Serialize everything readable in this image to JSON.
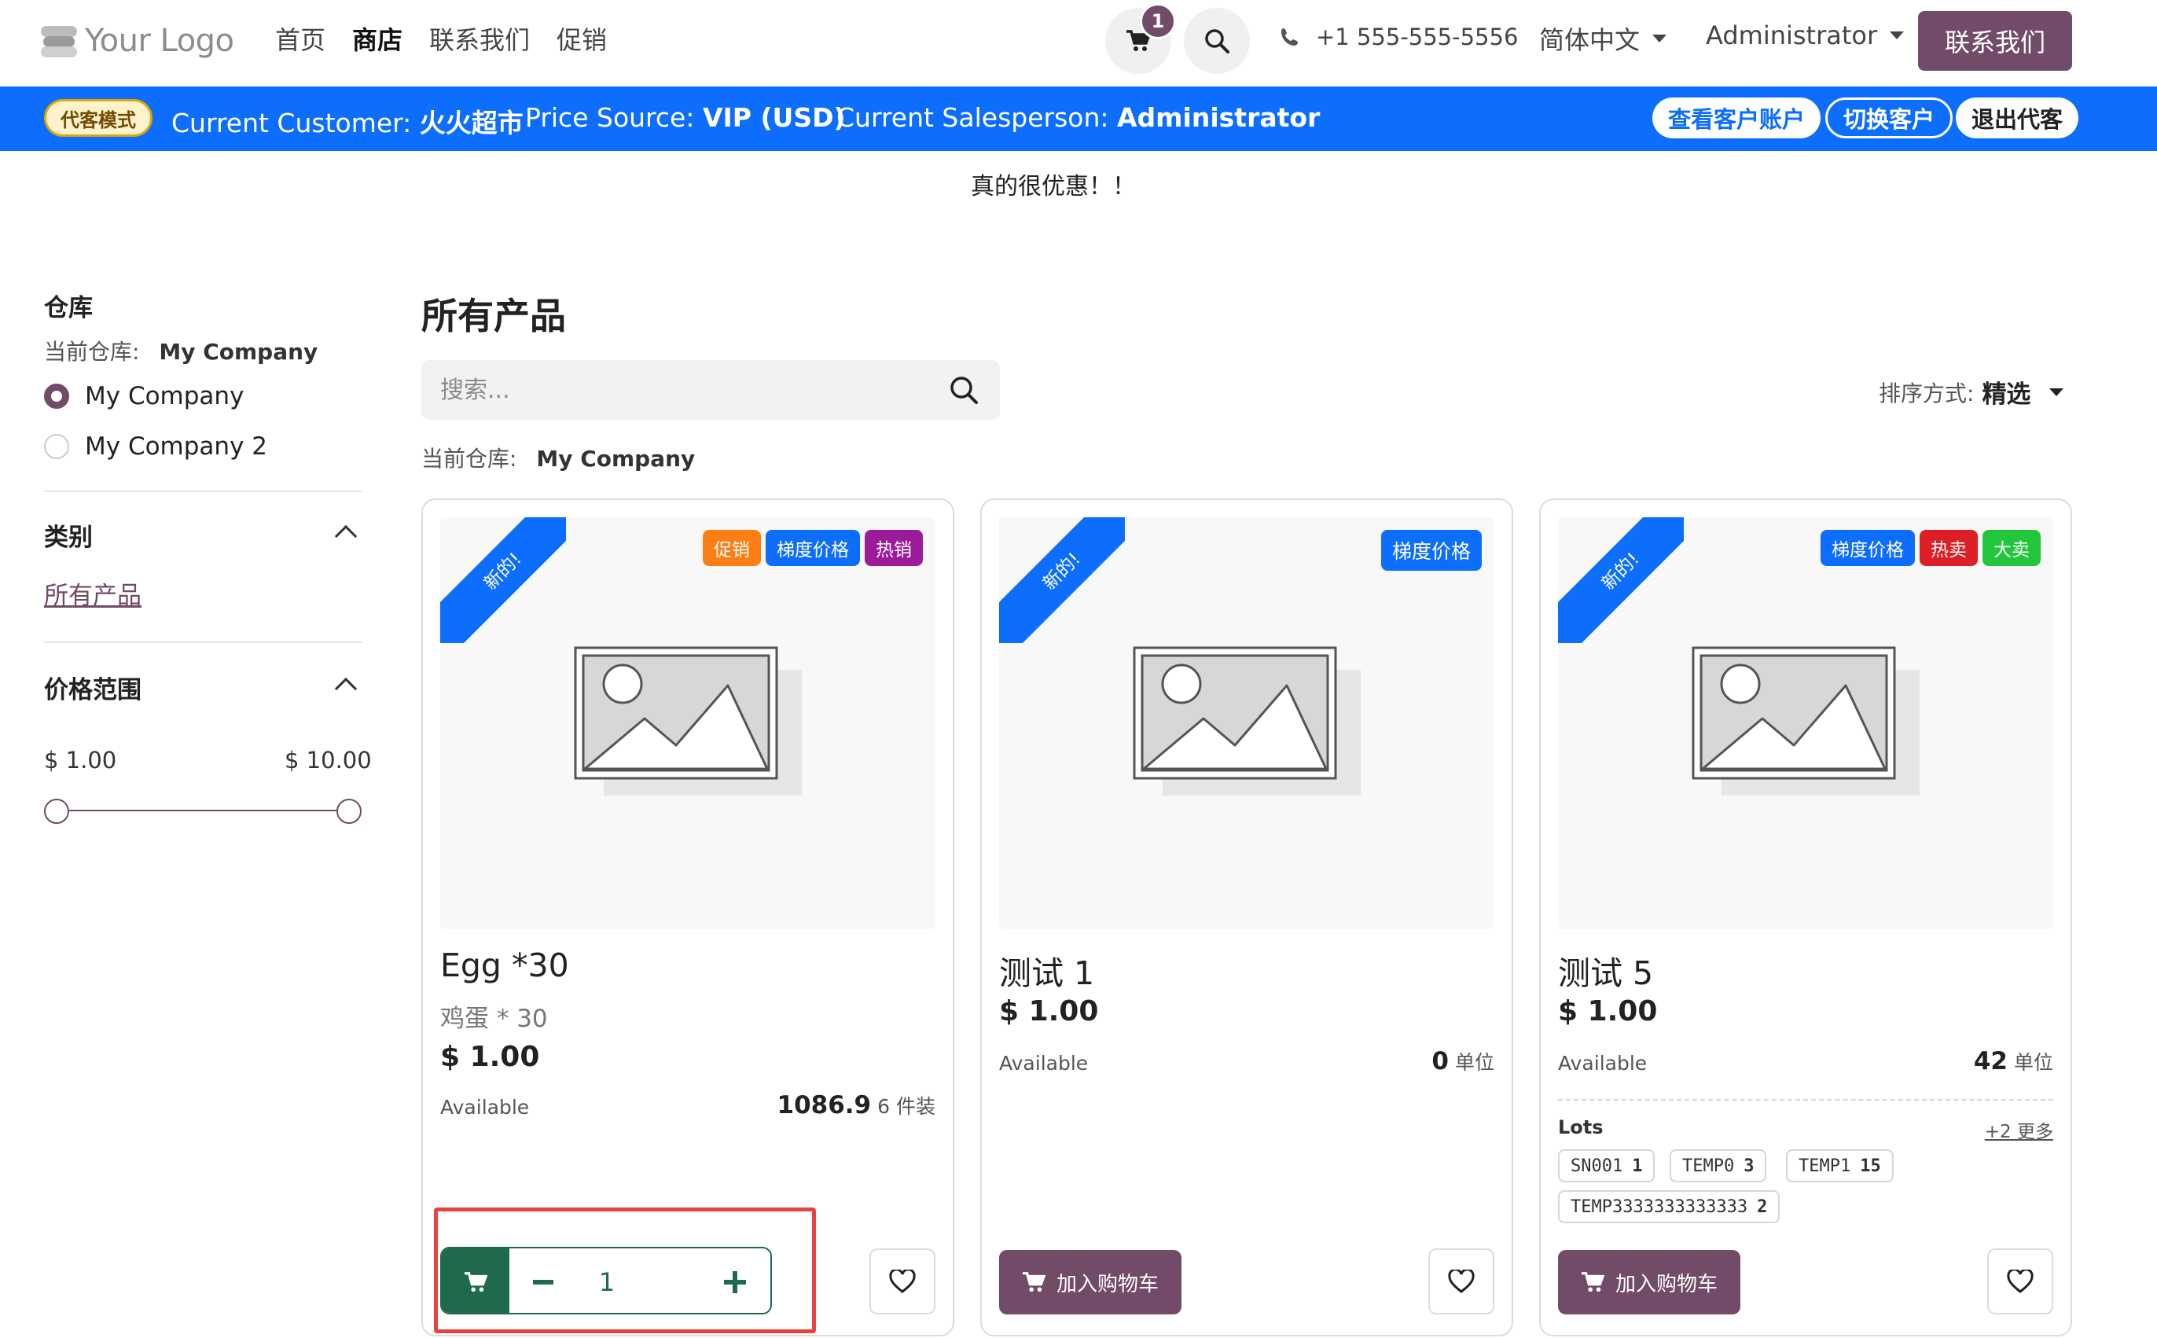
{
  "header": {
    "logo_text": "Your Logo",
    "nav": [
      "首页",
      "商店",
      "联系我们",
      "促销"
    ],
    "active_nav_index": 1,
    "cart_count": "1",
    "phone": "+1 555-555-5556",
    "language": "简体中文",
    "user": "Administrator",
    "contact_button": "联系我们"
  },
  "proxy_bar": {
    "badge": "代客模式",
    "customer_label": "Current Customer:",
    "customer_value": "火火超市",
    "price_label": "Price Source:",
    "price_value": "VIP (USD)",
    "salesperson_label": "Current Salesperson:",
    "salesperson_value": "Administrator",
    "view_account": "查看客户账户",
    "switch_customer": "切换客户",
    "exit_proxy": "退出代客"
  },
  "promo_text": "真的很优惠！！",
  "sidebar": {
    "warehouse_title": "仓库",
    "current_warehouse_label": "当前仓库:",
    "current_warehouse_value": "My Company",
    "warehouses": [
      {
        "label": "My Company",
        "selected": true
      },
      {
        "label": "My Company 2",
        "selected": false
      }
    ],
    "category_title": "类别",
    "category_link": "所有产品",
    "price_title": "价格范围",
    "price_min": "$ 1.00",
    "price_max": "$ 10.00"
  },
  "main": {
    "title": "所有产品",
    "search_placeholder": "搜索...",
    "sort_label": "排序方式:",
    "sort_value": "精选",
    "current_warehouse_label": "当前仓库:",
    "current_warehouse_value": "My Company"
  },
  "products": [
    {
      "ribbon": "新的!",
      "badges": [
        {
          "label": "促销",
          "color": "#fd7e14"
        },
        {
          "label": "梯度价格",
          "color": "#0d6efd"
        },
        {
          "label": "热销",
          "color": "#9c1b9b"
        }
      ],
      "name": "Egg *30",
      "subtitle": "鸡蛋 * 30",
      "price": "$ 1.00",
      "available_label": "Available",
      "qty": "1086.9",
      "unit": "6 件装",
      "quantity_input": "1"
    },
    {
      "ribbon": "新的!",
      "badges": [
        {
          "label": "梯度价格",
          "color": "#0d6efd"
        }
      ],
      "name": "测试 1",
      "price": "$ 1.00",
      "available_label": "Available",
      "qty": "0",
      "unit": "单位",
      "add_to_cart": "加入购物车"
    },
    {
      "ribbon": "新的!",
      "badges": [
        {
          "label": "梯度价格",
          "color": "#0d6efd"
        },
        {
          "label": "热卖",
          "color": "#dc1f26"
        },
        {
          "label": "大卖",
          "color": "#23c63a"
        }
      ],
      "name": "测试 5",
      "price": "$ 1.00",
      "available_label": "Available",
      "qty": "42",
      "unit": "单位",
      "lots_title": "Lots",
      "lots_more": "+2 更多",
      "lots": [
        {
          "code": "SN001",
          "qty": "1"
        },
        {
          "code": "TEMP0",
          "qty": "3"
        },
        {
          "code": "TEMP1",
          "qty": "15"
        },
        {
          "code": "TEMP3333333333333",
          "qty": "2"
        }
      ],
      "add_to_cart": "加入购物车"
    }
  ],
  "colors": {
    "brand": "#714b67",
    "proxy_bar": "#0d6efd",
    "qty_green": "#1f6a4d",
    "highlight": "#e8423f"
  }
}
